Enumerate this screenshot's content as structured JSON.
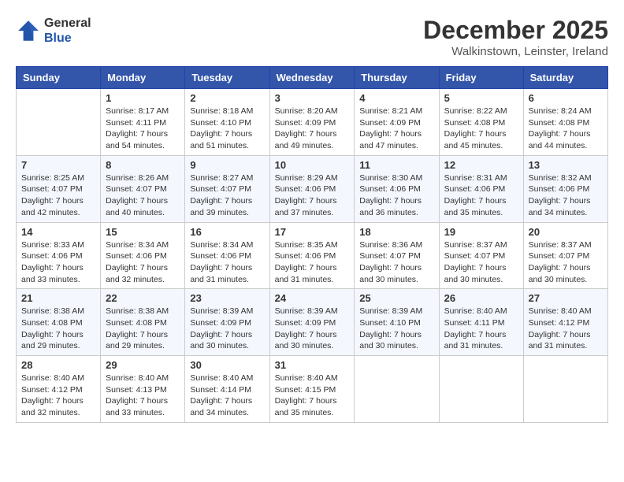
{
  "header": {
    "logo": {
      "line1": "General",
      "line2": "Blue"
    },
    "title": "December 2025",
    "location": "Walkinstown, Leinster, Ireland"
  },
  "days_of_week": [
    "Sunday",
    "Monday",
    "Tuesday",
    "Wednesday",
    "Thursday",
    "Friday",
    "Saturday"
  ],
  "weeks": [
    [
      {
        "day": "",
        "info": ""
      },
      {
        "day": "1",
        "info": "Sunrise: 8:17 AM\nSunset: 4:11 PM\nDaylight: 7 hours\nand 54 minutes."
      },
      {
        "day": "2",
        "info": "Sunrise: 8:18 AM\nSunset: 4:10 PM\nDaylight: 7 hours\nand 51 minutes."
      },
      {
        "day": "3",
        "info": "Sunrise: 8:20 AM\nSunset: 4:09 PM\nDaylight: 7 hours\nand 49 minutes."
      },
      {
        "day": "4",
        "info": "Sunrise: 8:21 AM\nSunset: 4:09 PM\nDaylight: 7 hours\nand 47 minutes."
      },
      {
        "day": "5",
        "info": "Sunrise: 8:22 AM\nSunset: 4:08 PM\nDaylight: 7 hours\nand 45 minutes."
      },
      {
        "day": "6",
        "info": "Sunrise: 8:24 AM\nSunset: 4:08 PM\nDaylight: 7 hours\nand 44 minutes."
      }
    ],
    [
      {
        "day": "7",
        "info": "Sunrise: 8:25 AM\nSunset: 4:07 PM\nDaylight: 7 hours\nand 42 minutes."
      },
      {
        "day": "8",
        "info": "Sunrise: 8:26 AM\nSunset: 4:07 PM\nDaylight: 7 hours\nand 40 minutes."
      },
      {
        "day": "9",
        "info": "Sunrise: 8:27 AM\nSunset: 4:07 PM\nDaylight: 7 hours\nand 39 minutes."
      },
      {
        "day": "10",
        "info": "Sunrise: 8:29 AM\nSunset: 4:06 PM\nDaylight: 7 hours\nand 37 minutes."
      },
      {
        "day": "11",
        "info": "Sunrise: 8:30 AM\nSunset: 4:06 PM\nDaylight: 7 hours\nand 36 minutes."
      },
      {
        "day": "12",
        "info": "Sunrise: 8:31 AM\nSunset: 4:06 PM\nDaylight: 7 hours\nand 35 minutes."
      },
      {
        "day": "13",
        "info": "Sunrise: 8:32 AM\nSunset: 4:06 PM\nDaylight: 7 hours\nand 34 minutes."
      }
    ],
    [
      {
        "day": "14",
        "info": "Sunrise: 8:33 AM\nSunset: 4:06 PM\nDaylight: 7 hours\nand 33 minutes."
      },
      {
        "day": "15",
        "info": "Sunrise: 8:34 AM\nSunset: 4:06 PM\nDaylight: 7 hours\nand 32 minutes."
      },
      {
        "day": "16",
        "info": "Sunrise: 8:34 AM\nSunset: 4:06 PM\nDaylight: 7 hours\nand 31 minutes."
      },
      {
        "day": "17",
        "info": "Sunrise: 8:35 AM\nSunset: 4:06 PM\nDaylight: 7 hours\nand 31 minutes."
      },
      {
        "day": "18",
        "info": "Sunrise: 8:36 AM\nSunset: 4:07 PM\nDaylight: 7 hours\nand 30 minutes."
      },
      {
        "day": "19",
        "info": "Sunrise: 8:37 AM\nSunset: 4:07 PM\nDaylight: 7 hours\nand 30 minutes."
      },
      {
        "day": "20",
        "info": "Sunrise: 8:37 AM\nSunset: 4:07 PM\nDaylight: 7 hours\nand 30 minutes."
      }
    ],
    [
      {
        "day": "21",
        "info": "Sunrise: 8:38 AM\nSunset: 4:08 PM\nDaylight: 7 hours\nand 29 minutes."
      },
      {
        "day": "22",
        "info": "Sunrise: 8:38 AM\nSunset: 4:08 PM\nDaylight: 7 hours\nand 29 minutes."
      },
      {
        "day": "23",
        "info": "Sunrise: 8:39 AM\nSunset: 4:09 PM\nDaylight: 7 hours\nand 30 minutes."
      },
      {
        "day": "24",
        "info": "Sunrise: 8:39 AM\nSunset: 4:09 PM\nDaylight: 7 hours\nand 30 minutes."
      },
      {
        "day": "25",
        "info": "Sunrise: 8:39 AM\nSunset: 4:10 PM\nDaylight: 7 hours\nand 30 minutes."
      },
      {
        "day": "26",
        "info": "Sunrise: 8:40 AM\nSunset: 4:11 PM\nDaylight: 7 hours\nand 31 minutes."
      },
      {
        "day": "27",
        "info": "Sunrise: 8:40 AM\nSunset: 4:12 PM\nDaylight: 7 hours\nand 31 minutes."
      }
    ],
    [
      {
        "day": "28",
        "info": "Sunrise: 8:40 AM\nSunset: 4:12 PM\nDaylight: 7 hours\nand 32 minutes."
      },
      {
        "day": "29",
        "info": "Sunrise: 8:40 AM\nSunset: 4:13 PM\nDaylight: 7 hours\nand 33 minutes."
      },
      {
        "day": "30",
        "info": "Sunrise: 8:40 AM\nSunset: 4:14 PM\nDaylight: 7 hours\nand 34 minutes."
      },
      {
        "day": "31",
        "info": "Sunrise: 8:40 AM\nSunset: 4:15 PM\nDaylight: 7 hours\nand 35 minutes."
      },
      {
        "day": "",
        "info": ""
      },
      {
        "day": "",
        "info": ""
      },
      {
        "day": "",
        "info": ""
      }
    ]
  ]
}
